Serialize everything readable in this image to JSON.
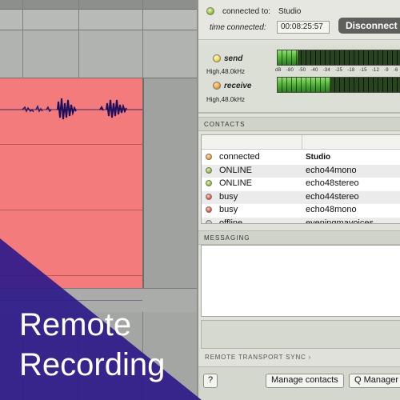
{
  "connection": {
    "connected_label": "connected to:",
    "connected_to": "Studio",
    "time_label": "time connected:",
    "time_value": "00:08:25:57",
    "disconnect_label": "Disconnect"
  },
  "meters": {
    "send_label": "send",
    "send_quality": "High,48.0kHz",
    "send_level": 0.16,
    "receive_label": "receive",
    "receive_quality": "High,48.0kHz",
    "receive_level": 0.42,
    "scale": [
      "dB",
      "-80",
      "-50",
      "-40",
      "-34",
      "-25",
      "-18",
      "-15",
      "-12",
      "-9",
      "-6"
    ]
  },
  "contacts": {
    "header": "CONTACTS",
    "rows": [
      {
        "status": "connected",
        "name": "Studio",
        "led": "orange"
      },
      {
        "status": "ONLINE",
        "name": "echo44mono",
        "led": "green"
      },
      {
        "status": "ONLINE",
        "name": "echo48stereo",
        "led": "green"
      },
      {
        "status": "busy",
        "name": "echo44stereo",
        "led": "red"
      },
      {
        "status": "busy",
        "name": "echo48mono",
        "led": "red"
      },
      {
        "status": "offline",
        "name": "eveningmayoices",
        "led": "grey"
      }
    ]
  },
  "messaging": {
    "header": "MESSAGING"
  },
  "sync": {
    "label": "REMOTE TRANSPORT SYNC"
  },
  "buttons": {
    "help": "?",
    "manage_contacts": "Manage contacts",
    "q_manager": "Q Manager"
  },
  "overlay": {
    "title_line1": "Remote",
    "title_line2": "Recording",
    "color": "#2e1a8a"
  }
}
